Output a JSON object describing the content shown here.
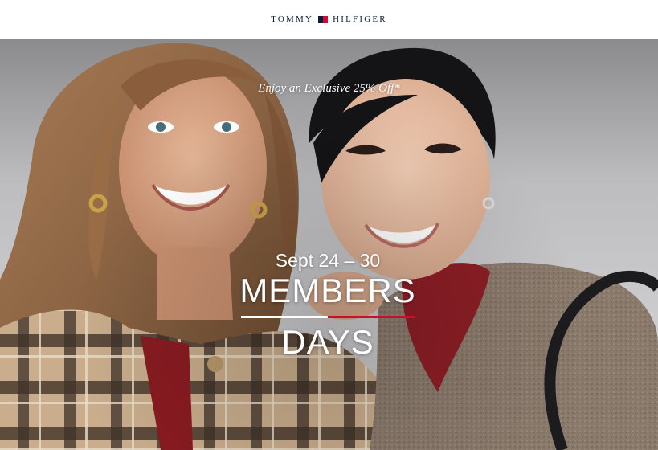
{
  "header": {
    "logo_left": "TOMMY",
    "logo_right": "HILFIGER"
  },
  "hero": {
    "promo": "Enjoy an Exclusive 25% Off*",
    "dates": "Sept 24 – 30",
    "headline_line1": "MEMBERS",
    "headline_line2": "DAYS",
    "image_description_icon": "two-smiling-women-photo-icon"
  },
  "colors": {
    "brand_navy": "#0b1b3a",
    "brand_red": "#c8102e",
    "text_on_image": "#ffffff"
  }
}
